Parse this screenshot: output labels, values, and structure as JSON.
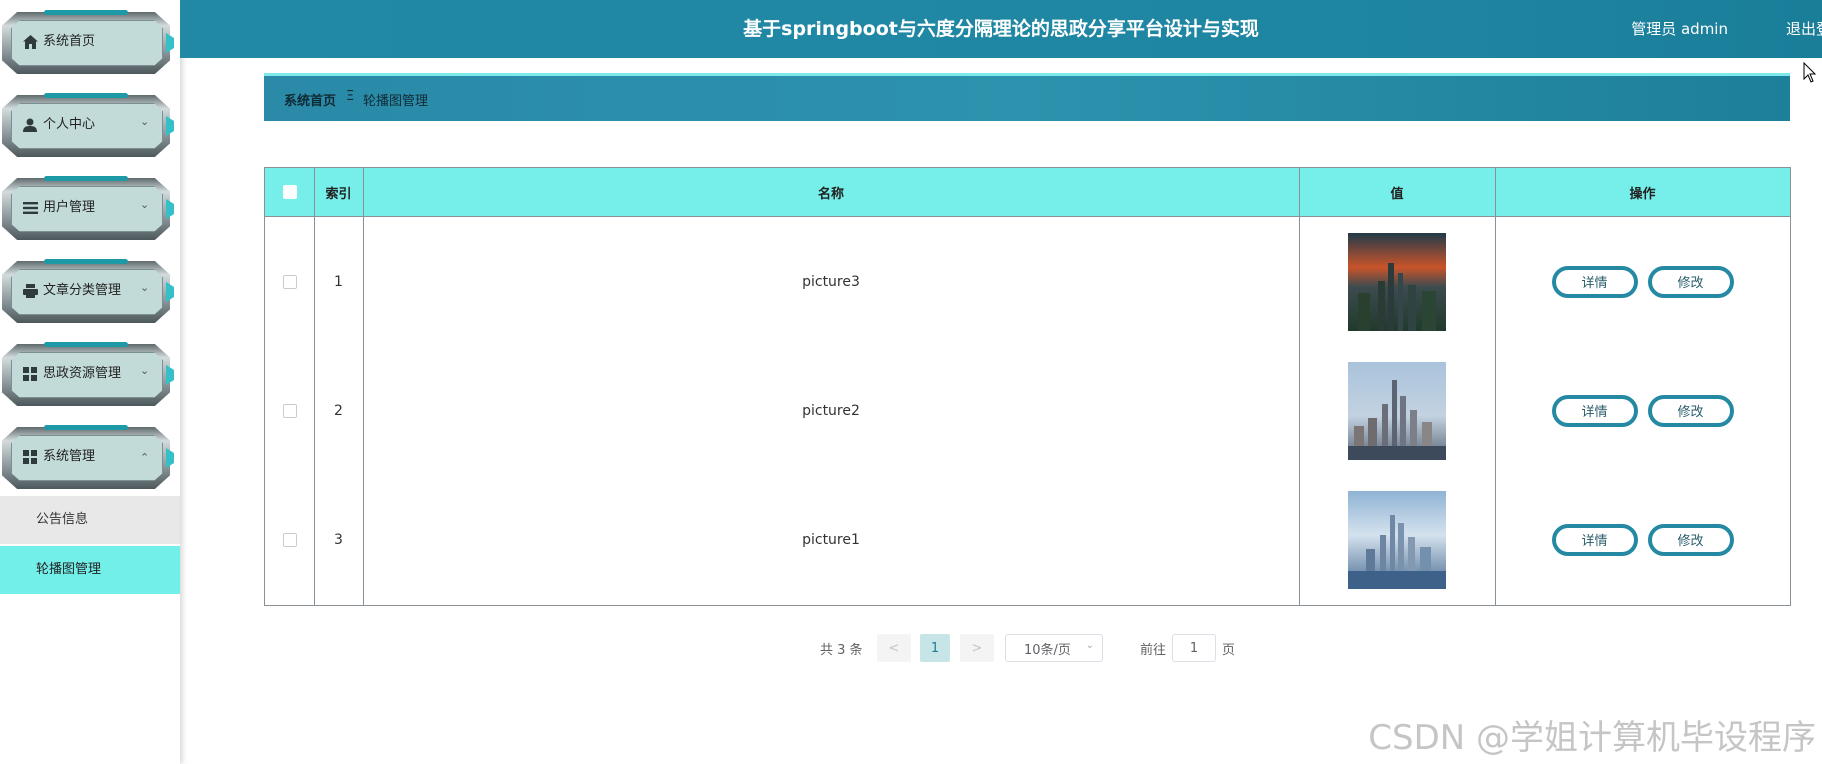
{
  "header": {
    "title": "基于springboot与六度分隔理论的思政分享平台设计与实现",
    "user": "管理员 admin",
    "logout": "退出登录"
  },
  "sidebar": {
    "items": [
      {
        "label": "系统首页",
        "icon": "home-icon"
      },
      {
        "label": "个人中心",
        "icon": "user-icon"
      },
      {
        "label": "用户管理",
        "icon": "list-icon"
      },
      {
        "label": "文章分类管理",
        "icon": "printer-icon"
      },
      {
        "label": "思政资源管理",
        "icon": "grid-icon"
      },
      {
        "label": "系统管理",
        "icon": "grid-icon"
      }
    ],
    "sub_items": [
      {
        "label": "公告信息"
      },
      {
        "label": "轮播图管理"
      }
    ]
  },
  "breadcrumb": {
    "home": "系统首页",
    "separator": "Ξ",
    "current": "轮播图管理"
  },
  "table": {
    "headers": [
      "索引",
      "名称",
      "值",
      "操作"
    ],
    "rows": [
      {
        "index": "1",
        "name": "picture3",
        "detail": "详情",
        "edit": "修改"
      },
      {
        "index": "2",
        "name": "picture2",
        "detail": "详情",
        "edit": "修改"
      },
      {
        "index": "3",
        "name": "picture1",
        "detail": "详情",
        "edit": "修改"
      }
    ]
  },
  "pagination": {
    "total": "共 3 条",
    "prev": "<",
    "page": "1",
    "next": ">",
    "page_size": "10条/页",
    "goto_prefix": "前往",
    "goto_value": "1",
    "goto_suffix": "页"
  },
  "watermark": "CSDN @学姐计算机毕设程序"
}
